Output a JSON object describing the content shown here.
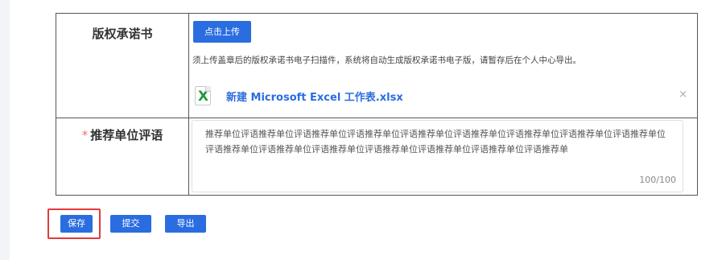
{
  "colors": {
    "primary": "#2a6de0",
    "required_star": "#f56c6c",
    "excel_green": "#1f9a3c",
    "highlight": "#e23b3b"
  },
  "form": {
    "copyright_row": {
      "label": "版权承诺书",
      "upload_button": "点击上传",
      "hint": "须上传盖章后的版权承诺书电子扫描件，系统将自动生成版权承诺书电子版，请暂存后在个人中心导出。",
      "file": {
        "icon": "excel-file-icon",
        "icon_glyph": "X",
        "name": "新建 Microsoft Excel 工作表.xlsx",
        "remove_glyph": "×"
      }
    },
    "review_row": {
      "required_mark": "*",
      "label": "推荐单位评语",
      "value": "推荐单位评语推荐单位评语推荐单位评语推荐单位评语推荐单位评语推荐单位评语推荐单位评语推荐单位评语推荐单位评语推荐单位评语推荐单位评语推荐单位评语推荐单位评语推荐单位评语推荐单位评语推荐单",
      "char_count": "100/100"
    }
  },
  "actions": {
    "save": "保存",
    "submit": "提交",
    "export": "导出"
  }
}
